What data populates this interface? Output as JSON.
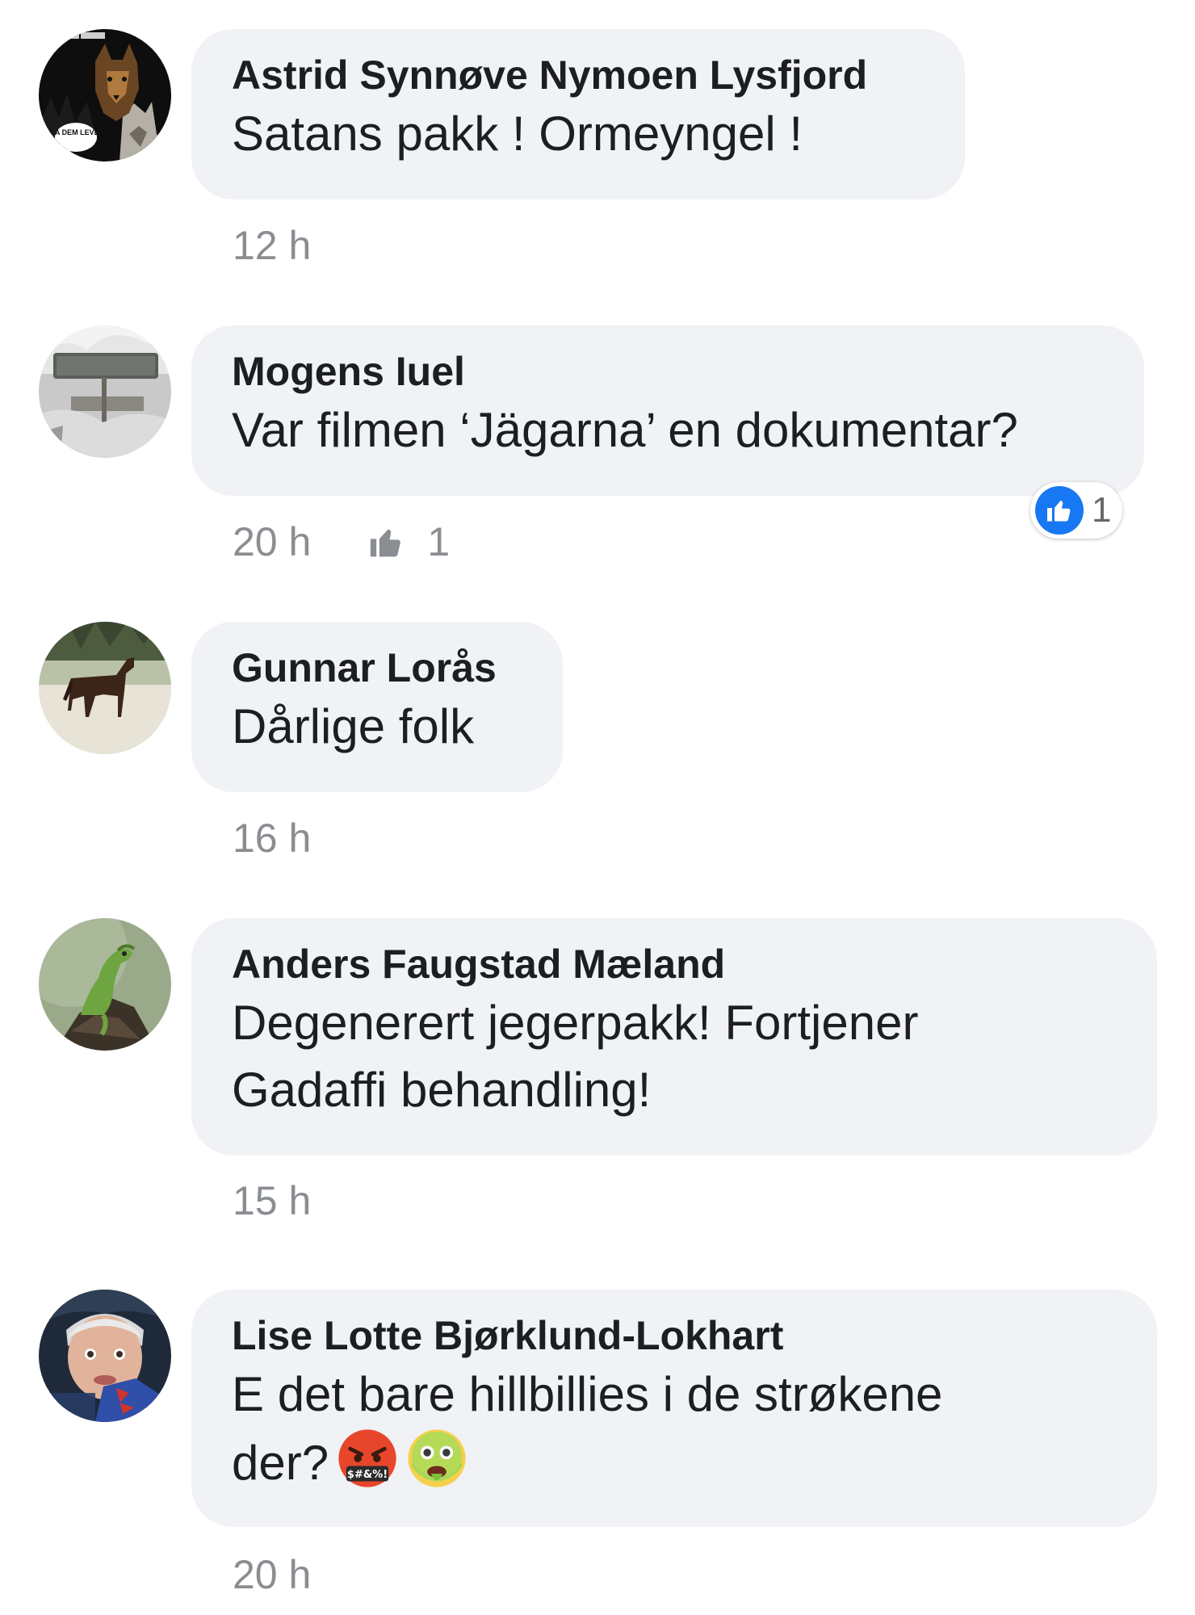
{
  "comments": [
    {
      "author": "Astrid Synnøve Nymoen Lysfjord",
      "text": "Satans pakk ! Ormeyngel !",
      "time": "12 h",
      "avatar_icon": "dog-wolf-avatar",
      "avatar_caption": "LA DEM LEVE!"
    },
    {
      "author": "Mogens Iuel",
      "text": "Var filmen ‘Jägarna’ en dokumentar?",
      "time": "20 h",
      "like_count": "1",
      "reaction_count": "1",
      "avatar_icon": "snowy-sign-avatar"
    },
    {
      "author": "Gunnar Lorås",
      "text": "Dårlige folk",
      "time": "16 h",
      "avatar_icon": "horse-field-avatar"
    },
    {
      "author": "Anders Faugstad Mæland",
      "text": "Degenerert jegerpakk! Fortjener\nGadaffi behandling!",
      "time": "15 h",
      "avatar_icon": "lizard-avatar"
    },
    {
      "author": "Lise Lotte Bjørklund-Lokhart",
      "text_line1": "E det bare hillbillies i de strøkene",
      "text_line2": "der?",
      "time": "20 h",
      "avatar_icon": "person-photo-avatar",
      "emojis": [
        "cursing-face-emoji",
        "nauseated-face-emoji"
      ]
    }
  ],
  "colors": {
    "bubble": "#f0f2f5",
    "author_text": "#1c1e21",
    "meta_text": "#8a8d91",
    "like_blue": "#1877f2"
  }
}
